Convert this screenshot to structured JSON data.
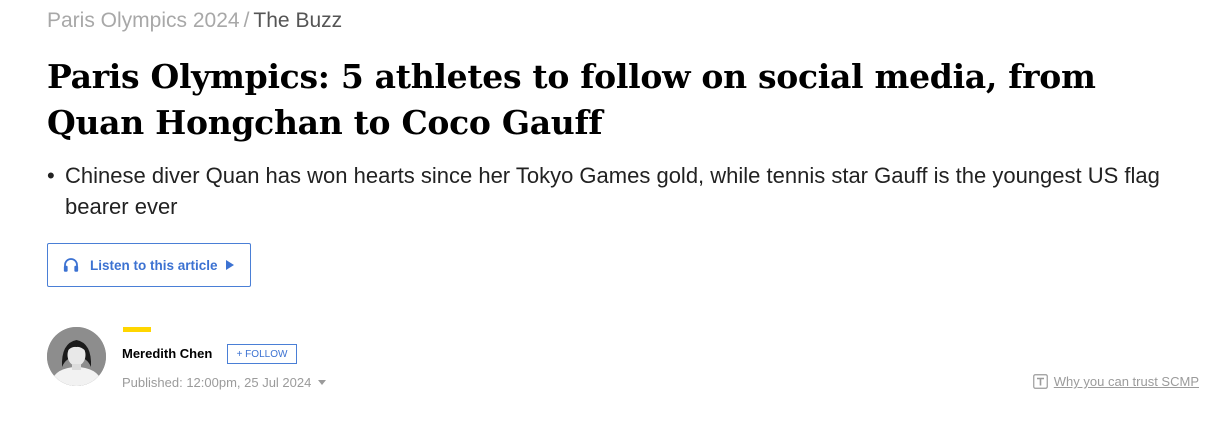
{
  "breadcrumb": {
    "section": "Paris Olympics 2024",
    "separator": "/",
    "current": "The Buzz"
  },
  "article": {
    "headline": "Paris Olympics: 5 athletes to follow on social media, from Quan Hongchan to Coco Gauff",
    "summary_bullet": "•",
    "summary": "Chinese diver Quan has won hearts since her Tokyo Games gold, while tennis star Gauff is the youngest US flag bearer ever"
  },
  "listen": {
    "label": "Listen to this article",
    "icon": "headphones-icon"
  },
  "author": {
    "name": "Meredith Chen",
    "follow_label": "+ FOLLOW",
    "published": "Published: 12:00pm, 25 Jul 2024"
  },
  "trust": {
    "label": "Why you can trust SCMP",
    "icon": "trust-badge-icon"
  },
  "colors": {
    "accent_blue": "#3c72d2",
    "accent_yellow": "#ffd600",
    "muted_gray": "#9b9b9b"
  }
}
